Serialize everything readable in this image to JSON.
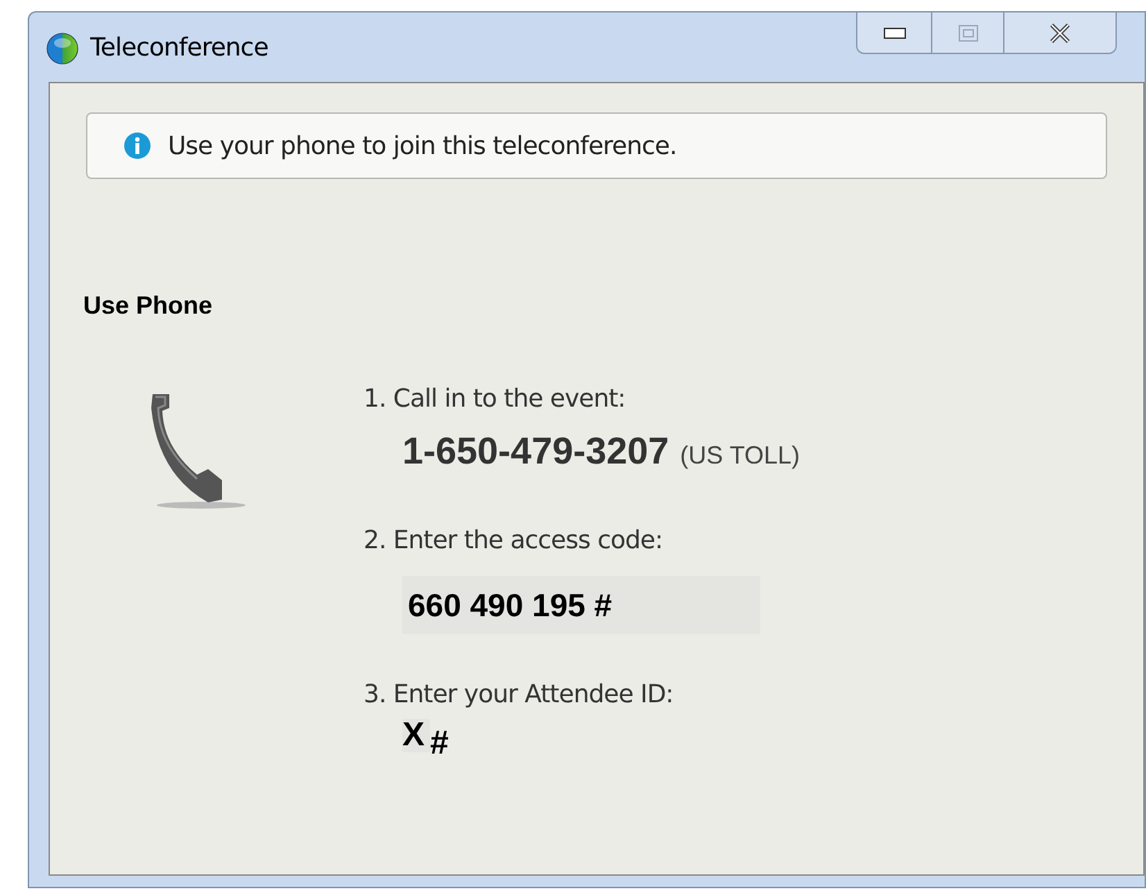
{
  "window": {
    "title": "Teleconference"
  },
  "info": {
    "message": "Use your phone to join this teleconference."
  },
  "section": {
    "heading": "Use Phone"
  },
  "steps": [
    {
      "kind": "phone",
      "label": "1. Call in to the event:",
      "number": "1-650-479-3207",
      "note": "(US TOLL)"
    },
    {
      "kind": "code",
      "label": "2. Enter the access code:",
      "code": "660 490 195 #"
    },
    {
      "kind": "attendee",
      "label": "3. Enter your Attendee ID:",
      "id": "X",
      "suffix": "#"
    }
  ]
}
